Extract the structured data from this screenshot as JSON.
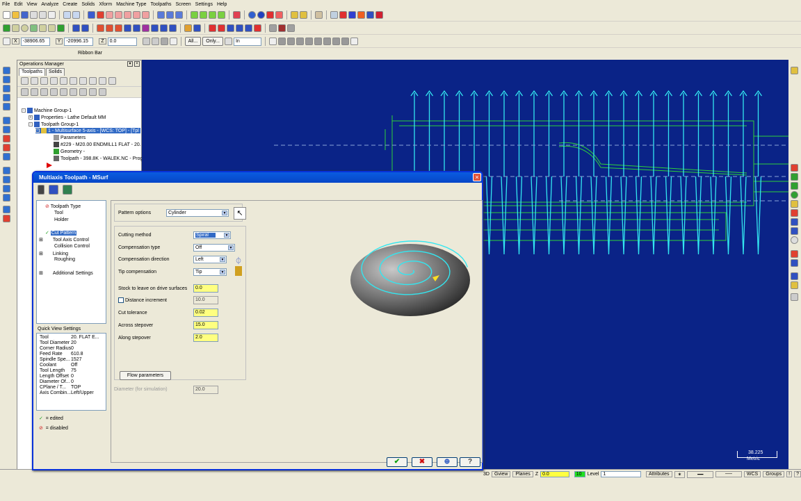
{
  "menu": [
    "File",
    "Edit",
    "View",
    "Analyze",
    "Create",
    "Solids",
    "Xform",
    "Machine Type",
    "Toolpaths",
    "Screen",
    "Settings",
    "Help"
  ],
  "coords": {
    "x_label": "X",
    "x_value": "-38906.65",
    "y_label": "Y",
    "y_value": "-20996.15",
    "z_label": "Z",
    "z_value": "0.0"
  },
  "ribbon": {
    "all_label": "All...",
    "only_label": "Only...",
    "in_value": "In",
    "label": "Ribbon Bar"
  },
  "ops": {
    "title": "Operations Manager",
    "tabs": [
      "Toolpaths",
      "Solids"
    ],
    "tree": [
      "Machine Group-1",
      "Properties - Lathe Default MM",
      "Toolpath Group-1",
      "1 - Multisurface 5-axis - [WCS: TOP] - [Tpl",
      "Parameters",
      "#229 - M20.00 ENDMILL1 FLAT -  20.",
      "Geometry -",
      "Toolpath - 398.8K - WALEK.NC - Progr"
    ]
  },
  "dialog": {
    "title": "Multiaxis Toolpath - MSurf",
    "nav": [
      "Toolpath Type",
      "Tool",
      "Holder",
      "Cut Pattern",
      "Tool Axis Control",
      "Collision Control",
      "Linking",
      "Roughing",
      "Additional Settings"
    ],
    "quick_view_label": "Quick View Settings",
    "quick_view": [
      {
        "k": "Tool",
        "v": "20. FLAT E..."
      },
      {
        "k": "Tool Diameter",
        "v": "20"
      },
      {
        "k": "Corner Radius",
        "v": "0"
      },
      {
        "k": "Feed Rate",
        "v": "610.8"
      },
      {
        "k": "Spindle Spe...",
        "v": "1527"
      },
      {
        "k": "Coolant",
        "v": "Off"
      },
      {
        "k": "Tool Length",
        "v": "75"
      },
      {
        "k": "Length Offset",
        "v": "0"
      },
      {
        "k": "Diameter Of...",
        "v": "0"
      },
      {
        "k": "CPlane / T...",
        "v": "TOP"
      },
      {
        "k": "Axis Combin...",
        "v": "Left/Upper"
      }
    ],
    "legend_edited": "= edited",
    "legend_disabled": "= disabled",
    "pattern_options_label": "Pattern options",
    "pattern_options_value": "Cylinder",
    "cutting_method_label": "Cutting method",
    "cutting_method_value": "Spiral",
    "compensation_type_label": "Compensation type",
    "compensation_type_value": "Off",
    "compensation_direction_label": "Compensation direction",
    "compensation_direction_value": "Left",
    "tip_compensation_label": "Tip compensation",
    "tip_compensation_value": "Tip",
    "stock_label": "Stock to leave on drive surfaces",
    "stock_value": "0.0",
    "distance_increment_label": "Distance increment",
    "distance_increment_value": "10.0",
    "cut_tolerance_label": "Cut tolerance",
    "cut_tolerance_value": "0.02",
    "across_stepover_label": "Across stepover",
    "across_stepover_value": "15.0",
    "along_stepover_label": "Along stepover",
    "along_stepover_value": "2.0",
    "flow_button": "Flow parameters",
    "diameter_label": "Diameter (for simulation)",
    "diameter_value": "20.0"
  },
  "viewport": {
    "scale_value": "38.225",
    "scale_unit": "Metric"
  },
  "status": {
    "items": [
      "3D",
      "Gview",
      "Planes"
    ],
    "z_label": "Z",
    "z_value": "0.0",
    "level_num": "10",
    "level_label": "Level",
    "level_value": "1",
    "attributes": "Attributes",
    "wcs": "WCS",
    "groups": "Groups"
  },
  "colors": {
    "viewport_bg": "#0a2387",
    "toolpath": "#33e6f0",
    "geometry": "#2ed23a",
    "title_bar": "#0a5ce0",
    "highlight": "#ffff80"
  }
}
